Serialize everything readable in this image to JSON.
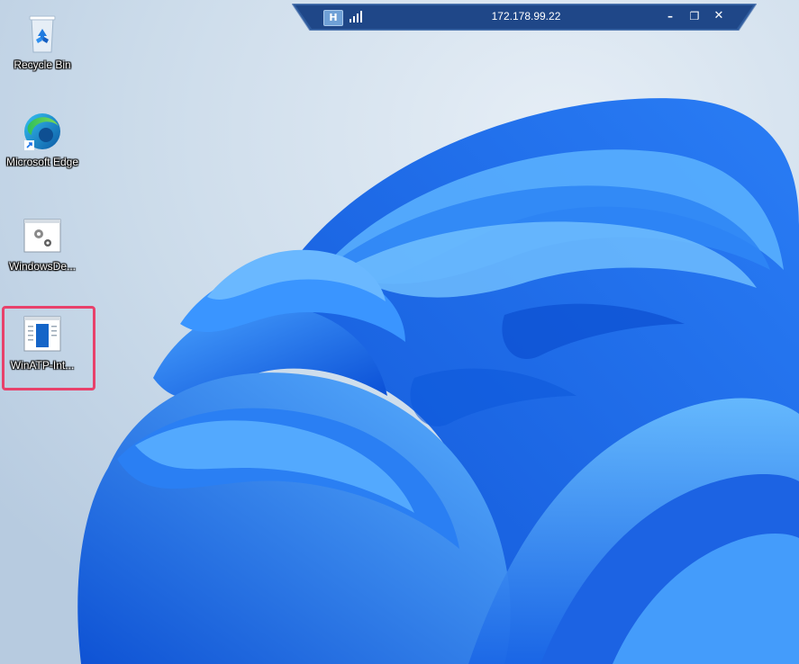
{
  "connection_bar": {
    "pin_label": "H",
    "host_address": "172.178.99.22",
    "minimize_label": "–",
    "restore_label": "❐",
    "close_label": "✕",
    "bar_color": "#2f5c9e"
  },
  "desktop_icons": [
    {
      "label": "Recycle Bin",
      "icon": "recycle-bin-icon"
    },
    {
      "label": "Microsoft Edge",
      "icon": "edge-icon"
    },
    {
      "label": "WindowsDe...",
      "icon": "gear-window-icon"
    },
    {
      "label": "WinATP-Int...",
      "icon": "document-window-icon"
    }
  ],
  "highlight_color": "#e8416b"
}
